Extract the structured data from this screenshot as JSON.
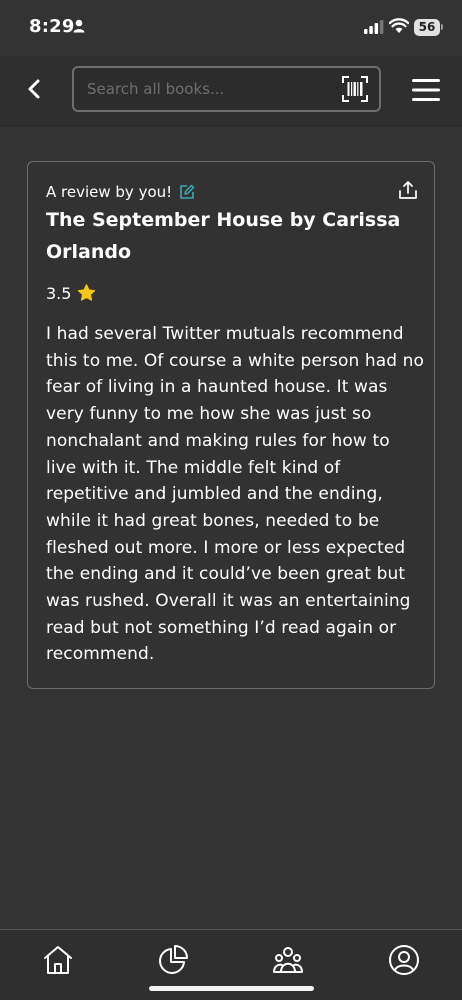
{
  "status_bar": {
    "time": "8:29",
    "battery": "56",
    "icons": [
      "person-icon",
      "signal-icon",
      "wifi-icon",
      "battery-icon"
    ]
  },
  "header": {
    "search_placeholder": "Search all books...",
    "icons": [
      "chevron-left-icon",
      "barcode-scan-icon",
      "hamburger-menu-icon"
    ]
  },
  "review": {
    "by_label": "A review by you!",
    "title": "The September House by Carissa Orlando",
    "rating": "3.5",
    "body": "I had several Twitter mutuals recommend this to me. Of course a white person had no fear of living in a haunted house. It was very funny to me how she was just so nonchalant and making rules for how to live with it. The middle felt kind of repetitive and jumbled and the ending, while it had great bones, needed to be fleshed out more. I more or less expected the ending and it could’ve been great but was rushed. Overall it was an entertaining read but not something I’d read again or recommend.",
    "icons": [
      "edit-icon",
      "share-icon",
      "star-icon"
    ]
  },
  "bottom_nav": {
    "items": [
      "home-icon",
      "chart-icon",
      "community-icon",
      "profile-icon"
    ]
  },
  "colors": {
    "background": "#333333",
    "card_border": "#6c6c6c",
    "edit_accent": "#3fa7b5",
    "star": "#f5c518"
  }
}
